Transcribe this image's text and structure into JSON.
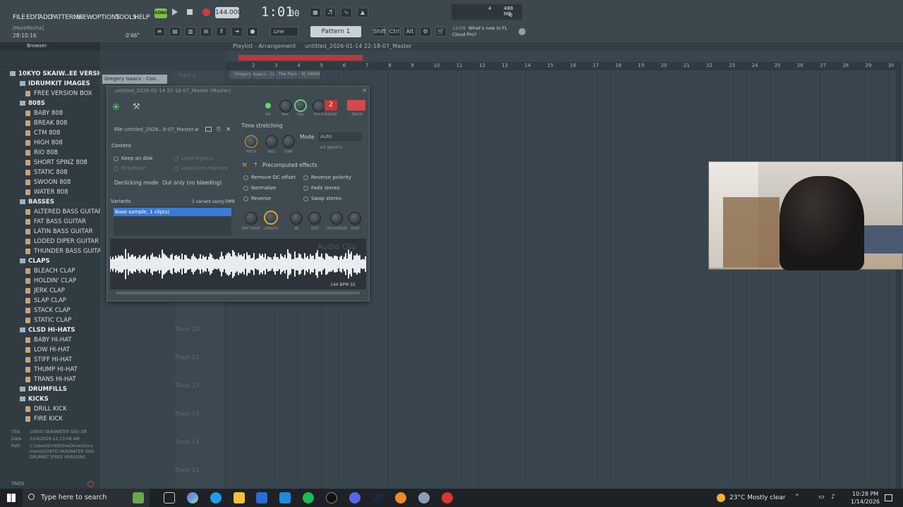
{
  "menu": [
    "FILE",
    "EDIT",
    "ADD",
    "PATTERNS",
    "VIEW",
    "OPTIONS",
    "TOOLS",
    "HELP"
  ],
  "transport": {
    "song_mode": "SONG",
    "tempo": "144.000",
    "time": "1:01",
    "time_sub": "00",
    "pattern": "Pattern 1",
    "snap": "Line"
  },
  "hint": {
    "user": "[MarkRocha]",
    "time": "28:10:16",
    "offset": "0'46\""
  },
  "monitor": {
    "cpu": "4",
    "ram": "488 MB",
    "poly": "0"
  },
  "news": {
    "date": "12/09",
    "line1": "What's new in FL",
    "line2": "Cloud Pro?"
  },
  "toolbar_labels": {
    "shift": "Shift",
    "ctrl": "Ctrl",
    "alt": "Alt"
  },
  "browser": {
    "title": "Browser",
    "items": [
      {
        "label": "10KYO SKAIW..EE VERSION]",
        "kind": "root"
      },
      {
        "label": "IDRUMKIT IMAGES",
        "kind": "folder"
      },
      {
        "label": "FREE VERSION BOX",
        "kind": "file"
      },
      {
        "label": "808S",
        "kind": "folder"
      },
      {
        "label": "BABY 808",
        "kind": "file"
      },
      {
        "label": "BREAK 808",
        "kind": "file"
      },
      {
        "label": "CTM 808",
        "kind": "file"
      },
      {
        "label": "HIGH 808",
        "kind": "file"
      },
      {
        "label": "RIO 808",
        "kind": "file"
      },
      {
        "label": "SHORT SPINZ 808",
        "kind": "file"
      },
      {
        "label": "STATIC 808",
        "kind": "file"
      },
      {
        "label": "SWOON 808",
        "kind": "file"
      },
      {
        "label": "WATER 808",
        "kind": "file"
      },
      {
        "label": "BASSES",
        "kind": "folder"
      },
      {
        "label": "ALTERED BASS GUITAR",
        "kind": "file"
      },
      {
        "label": "FAT BASS GUITAR",
        "kind": "file"
      },
      {
        "label": "LATIN BASS GUITAR",
        "kind": "file"
      },
      {
        "label": "LODED DIPER GUITAR",
        "kind": "file"
      },
      {
        "label": "THUNDER BASS GUITAR",
        "kind": "file"
      },
      {
        "label": "CLAPS",
        "kind": "folder"
      },
      {
        "label": "BLEACH CLAP",
        "kind": "file"
      },
      {
        "label": "HOLDIN' CLAP",
        "kind": "file"
      },
      {
        "label": "JERK CLAP",
        "kind": "file"
      },
      {
        "label": "SLAP CLAP",
        "kind": "file"
      },
      {
        "label": "STACK CLAP",
        "kind": "file"
      },
      {
        "label": "STATIC CLAP",
        "kind": "file"
      },
      {
        "label": "CLSD HI-HATS",
        "kind": "folder"
      },
      {
        "label": "BABY HI-HAT",
        "kind": "file"
      },
      {
        "label": "LOW HI-HAT",
        "kind": "file"
      },
      {
        "label": "STIFF HI-HAT",
        "kind": "file"
      },
      {
        "label": "THUMP HI-HAT",
        "kind": "file"
      },
      {
        "label": "TRANS HI-HAT",
        "kind": "file"
      },
      {
        "label": "DRUMFILLS",
        "kind": "folder"
      },
      {
        "label": "KICKS",
        "kind": "folder"
      },
      {
        "label": "DRILL KICK",
        "kind": "file"
      },
      {
        "label": "FIRE KICK",
        "kind": "file"
      }
    ],
    "info": {
      "title_label": "Title",
      "title": "10KYO SKAIWATER GIGI DR",
      "date_label": "Date",
      "date": "1/14/2026 12:13:06 AM",
      "path_label": "Path",
      "path": "C:\\Users\\lordd\\OneDrive\\Documents\\10KYO SKAIWATER GIGI DRUMKIT [FREE VERSION]"
    },
    "tags": "TAGS"
  },
  "playlist": {
    "title": "Playlist - Arrangement",
    "project": "untitled_2026-01-14 22-18-07_Master",
    "clip_label": "Gregory Isaacs - Co..The Pace - M_YAMM",
    "channel_label": "Gregory Isaacs - Coo..",
    "bars": [
      "2",
      "3",
      "4",
      "5",
      "6",
      "7",
      "8",
      "9",
      "10",
      "11",
      "12",
      "13",
      "14",
      "15",
      "16",
      "17",
      "18",
      "19",
      "20",
      "21",
      "22",
      "23",
      "24",
      "25",
      "26",
      "27",
      "28",
      "29",
      "30"
    ],
    "tracks": [
      "Track 1",
      "Track 10",
      "Track 11",
      "Track 12",
      "Track 13",
      "Track 14",
      "Track 15"
    ]
  },
  "plugin": {
    "title": "untitled_2026-01-14 22-18-07_Master (Master)",
    "file_label": "File",
    "file_name": "untitled_2026...8-07_Master.wav",
    "content_label": "Content",
    "keep_on_disk": "Keep on disk",
    "resample": "Resample",
    "load_regions": "Load regions",
    "load_slice_markers": "Load slice markers",
    "declick_label": "Declicking mode",
    "declick_value": "Out only (no bleeding)",
    "variants_label": "Variants",
    "variants_info": "1 variant using DMB",
    "variant_item": "Base sample, 1 clip(s)",
    "knob_labels": [
      "ON",
      "PAN",
      "VOL",
      "PITCH",
      "RANGE",
      "TRACK"
    ],
    "track_num": "2",
    "time_stretch_label": "Time stretching",
    "mode_label": "Mode",
    "mode_value": "Auto",
    "engine": "e3 generic",
    "ts_knobs": [
      "PITCH",
      "MUL",
      "TIME"
    ],
    "precomp_label": "Precomputed effects",
    "effects_left": [
      "Remove DC offset",
      "Normalize",
      "Reverse"
    ],
    "effects_right": [
      "Reverse polarity",
      "Fade stereo",
      "Swap stereo"
    ],
    "env_knobs": [
      "SMP START",
      "LENGTH",
      "IN",
      "OUT",
      "CROSSFADE",
      "TRIM"
    ],
    "watermark": "Audio Clip",
    "bpm_info": "144 BPM 32"
  },
  "taskbar": {
    "search": "Type here to search",
    "weather": "23°C  Mostly clear",
    "time": "10:28 PM",
    "date": "1/14/2026"
  }
}
